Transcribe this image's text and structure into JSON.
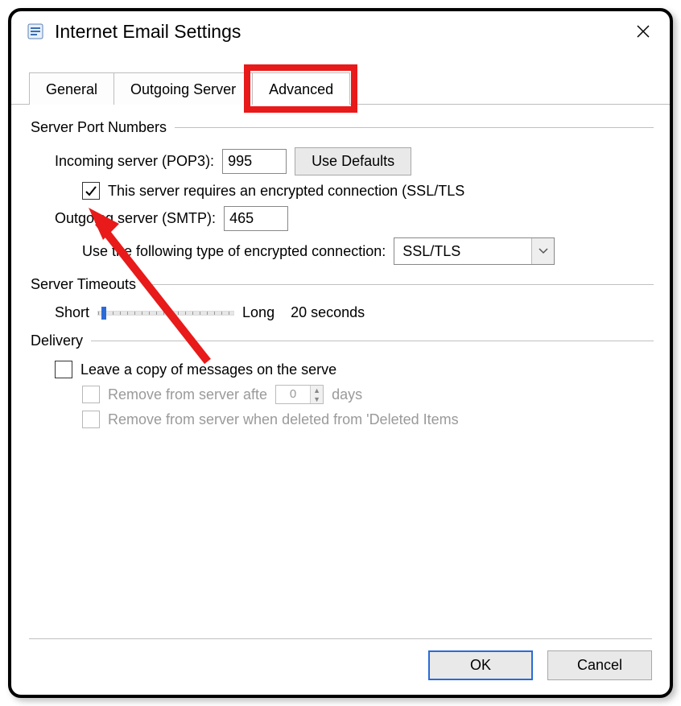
{
  "window": {
    "title": "Internet Email Settings"
  },
  "tabs": {
    "general": "General",
    "outgoing": "Outgoing Server",
    "advanced": "Advanced"
  },
  "sections": {
    "ports": {
      "title": "Server Port Numbers",
      "incoming_label": "Incoming server (POP3):",
      "incoming_value": "995",
      "use_defaults": "Use Defaults",
      "ssl_checkbox": "This server requires an encrypted connection (SSL/TLS",
      "outgoing_label": "Outgoing server (SMTP):",
      "outgoing_value": "465",
      "enc_label": "Use the following type of encrypted connection:",
      "enc_value": "SSL/TLS"
    },
    "timeouts": {
      "title": "Server Timeouts",
      "short": "Short",
      "long": "Long",
      "value": "20 seconds"
    },
    "delivery": {
      "title": "Delivery",
      "leave_copy": "Leave a copy of messages on the serve",
      "remove_after": "Remove from server afte",
      "days_value": "0",
      "days_label": "days",
      "remove_deleted": "Remove from server when deleted from 'Deleted Items"
    }
  },
  "footer": {
    "ok": "OK",
    "cancel": "Cancel"
  }
}
